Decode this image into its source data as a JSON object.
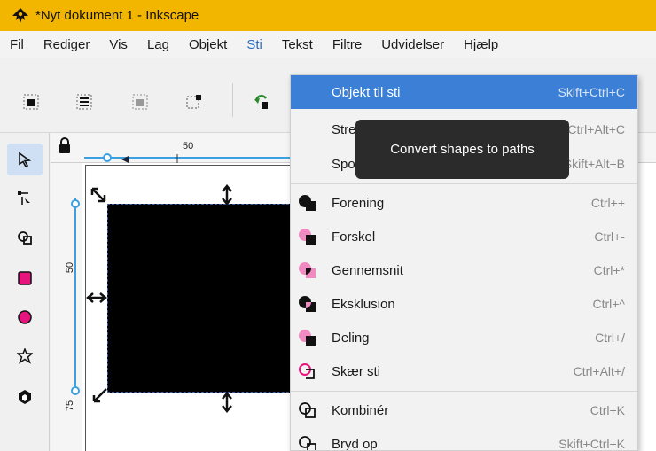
{
  "window": {
    "title": "*Nyt dokument 1 - Inkscape"
  },
  "menubar": {
    "items": [
      "Fil",
      "Rediger",
      "Vis",
      "Lag",
      "Objekt",
      "Sti",
      "Tekst",
      "Filtre",
      "Udvidelser",
      "Hjælp"
    ],
    "active": "Sti"
  },
  "ruler": {
    "h_label": "50",
    "v_labels": [
      "50",
      "75"
    ]
  },
  "menu": {
    "items": [
      {
        "label": "Objekt til sti",
        "shortcut": "Skift+Ctrl+C",
        "icon": "none",
        "highlighted": true
      },
      {
        "label": "Streg til sti",
        "shortcut": "Ctrl+Alt+C",
        "icon": "none"
      },
      {
        "label": "Spor billede ...",
        "shortcut": "Skift+Alt+B",
        "icon": "none"
      },
      {
        "label": "Forening",
        "shortcut": "Ctrl++",
        "icon": "union-icon"
      },
      {
        "label": "Forskel",
        "shortcut": "Ctrl+-",
        "icon": "difference-icon"
      },
      {
        "label": "Gennemsnit",
        "shortcut": "Ctrl+*",
        "icon": "intersection-icon"
      },
      {
        "label": "Eksklusion",
        "shortcut": "Ctrl+^",
        "icon": "exclusion-icon"
      },
      {
        "label": "Deling",
        "shortcut": "Ctrl+/",
        "icon": "division-icon"
      },
      {
        "label": "Skær sti",
        "shortcut": "Ctrl+Alt+/",
        "icon": "cut-path-icon"
      },
      {
        "label": "Kombinér",
        "shortcut": "Ctrl+K",
        "icon": "combine-icon"
      },
      {
        "label": "Bryd op",
        "shortcut": "Skift+Ctrl+K",
        "icon": "break-apart-icon"
      }
    ]
  },
  "tooltip": {
    "text": "Convert shapes to paths"
  },
  "colors": {
    "titlebar": "#f2b600",
    "highlight": "#3c7fd6",
    "accent": "#2c6cc4"
  }
}
